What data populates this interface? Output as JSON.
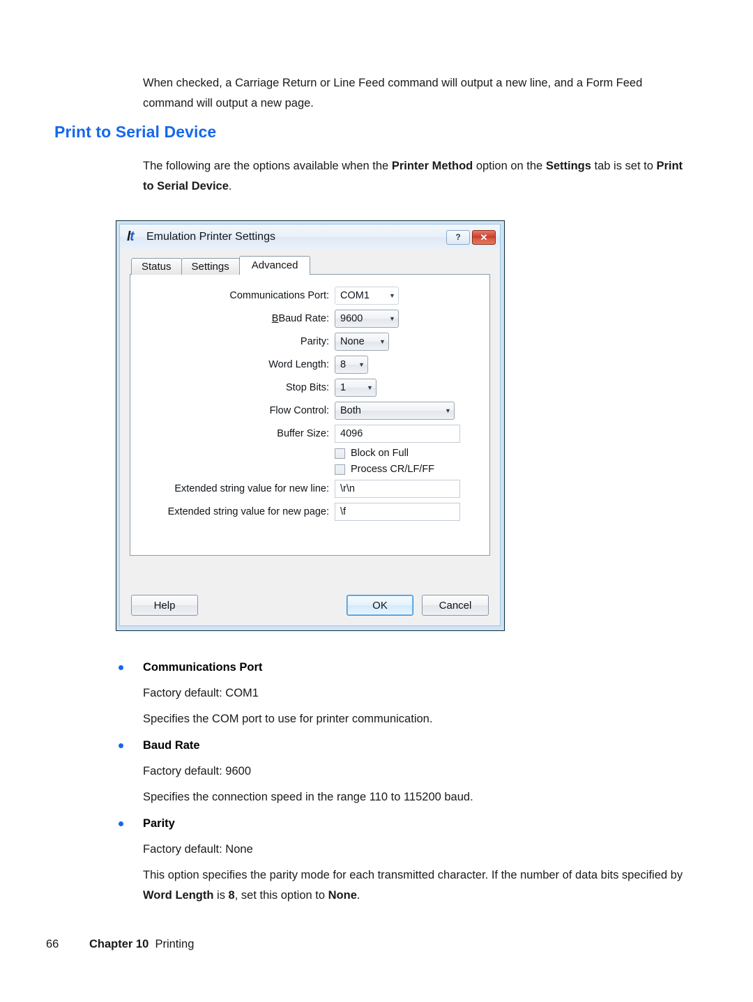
{
  "page": {
    "intro_paragraph": "When checked, a Carriage Return or Line Feed command will output a new line, and a Form Feed command will output a new page.",
    "section_heading": "Print to Serial Device",
    "lead_prefix": "The following are the options available when the ",
    "lead_bold_1": "Printer Method",
    "lead_mid": " option on the ",
    "lead_bold_2": "Settings",
    "lead_suffix": " tab is set to ",
    "lead_bold_3": "Print to Serial Device",
    "lead_period": "."
  },
  "dialog": {
    "title": "Emulation Printer Settings",
    "icon_label": "lt",
    "help_button": "?",
    "close_button": "✕",
    "tabs": [
      {
        "label": "Status",
        "active": false
      },
      {
        "label": "Settings",
        "active": false
      },
      {
        "label": "Advanced",
        "active": true
      }
    ],
    "fields": {
      "comm_port_label": "Communications Port:",
      "comm_port_value": "COM1",
      "baud_rate_label": "Baud Rate:",
      "baud_rate_value": "9600",
      "parity_label": "Parity:",
      "parity_value": "None",
      "word_length_label": "Word Length:",
      "word_length_value": "8",
      "stop_bits_label": "Stop Bits:",
      "stop_bits_value": "1",
      "flow_control_label": "Flow Control:",
      "flow_control_value": "Both",
      "buffer_size_label": "Buffer Size:",
      "buffer_size_value": "4096",
      "block_on_full_label": "Block on Full",
      "process_crlfff_label": "Process CR/LF/FF",
      "new_line_label": "Extended string value for new line:",
      "new_line_value": "\\r\\n",
      "new_page_label": "Extended string value for new page:",
      "new_page_value": "\\f"
    },
    "buttons": {
      "help": "Help",
      "ok": "OK",
      "cancel": "Cancel"
    },
    "accent_default_border": "#3c8fd6",
    "close_button_color": "#c33a26"
  },
  "options": [
    {
      "term": "Communications Port",
      "default_line": "Factory default: COM1",
      "description": "Specifies the COM port to use for printer communication."
    },
    {
      "term": "Baud Rate",
      "default_line": "Factory default: 9600",
      "description": "Specifies the connection speed in the range 110 to 115200 baud."
    },
    {
      "term": "Parity",
      "default_line": "Factory default: None",
      "desc_prefix": "This option specifies the parity mode for each transmitted character. If the number of data bits specified by ",
      "desc_bold_1": "Word Length",
      "desc_mid": " is ",
      "desc_bold_2": "8",
      "desc_mid_2": ", set this option to ",
      "desc_bold_3": "None",
      "desc_suffix": "."
    }
  ],
  "footer": {
    "page_number": "66",
    "chapter": "Chapter 10",
    "chapter_title": "Printing"
  },
  "theme": {
    "heading_blue": "#1567ec",
    "bullet_blue": "#1567ec",
    "text_black": "#1a1a1a"
  }
}
